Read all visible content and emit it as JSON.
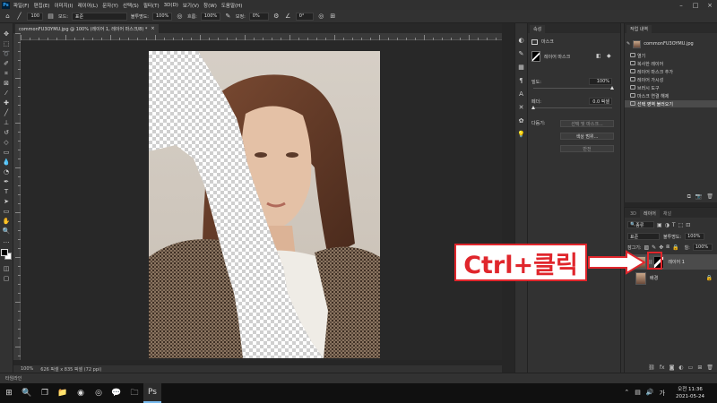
{
  "app": {
    "logo": "Ps",
    "menu": [
      "파일(F)",
      "편집(E)",
      "이미지(I)",
      "레이어(L)",
      "문자(Y)",
      "선택(S)",
      "필터(T)",
      "3D(D)",
      "보기(V)",
      "창(W)",
      "도움말(H)"
    ]
  },
  "options": {
    "brush_size": "100",
    "mode_label": "모드:",
    "mode_value": "표준",
    "opacity_label": "불투명도:",
    "opacity_value": "100%",
    "flow_label": "흐름:",
    "flow_value": "100%",
    "smoothing_label": "보정:",
    "smoothing_value": "0%",
    "angle_value": "0°"
  },
  "document": {
    "tab_title": "commonFU3OYMU.jpg @ 100% (레이어 1, 레이어 마스크/8) *",
    "close": "×",
    "status_zoom": "100%",
    "status_info": "626 픽셀 x 835 픽셀 (72 ppi)"
  },
  "bottom_label": "타임라인",
  "properties": {
    "tab": "속성",
    "title": "마스크",
    "mask_label": "레이어 마스크",
    "density_label": "밀도:",
    "density_value": "100%",
    "density_level": 1.0,
    "feather_label": "페더:",
    "feather_value": "0.0 픽셀",
    "feather_level": 0.0,
    "refine_label": "다듬기:",
    "select_mask_btn": "선택 및 마스크...",
    "color_range_btn": "색상 범위...",
    "invert_btn": "반전"
  },
  "history": {
    "tab": "작업 내역",
    "snapshot": "commonFU3OYMU.jpg",
    "items": [
      "열기",
      "복사한 레이어",
      "레이어 마스크 추가",
      "레이어 가시성",
      "브러시 도구",
      "마스크 연결 해제",
      "선택 영역 불러오기"
    ],
    "selected_index": 6
  },
  "layers": {
    "tabs": [
      "3D",
      "레이어",
      "채널"
    ],
    "active_tab_index": 1,
    "filter_kind": "종류",
    "blend_mode": "표준",
    "opacity_label": "불투명도:",
    "opacity_value": "100%",
    "lock_label": "잠그기:",
    "fill_label": "칠:",
    "fill_value": "100%",
    "rows": [
      {
        "name": "레이어 1",
        "active": true,
        "has_mask": true
      },
      {
        "name": "배경",
        "active": false,
        "has_mask": false,
        "locked": true
      }
    ]
  },
  "annotation": {
    "text": "Ctrl+클릭",
    "color": "#e0262c"
  },
  "taskbar": {
    "time": "오전 11:36",
    "date": "2021-05-24"
  }
}
